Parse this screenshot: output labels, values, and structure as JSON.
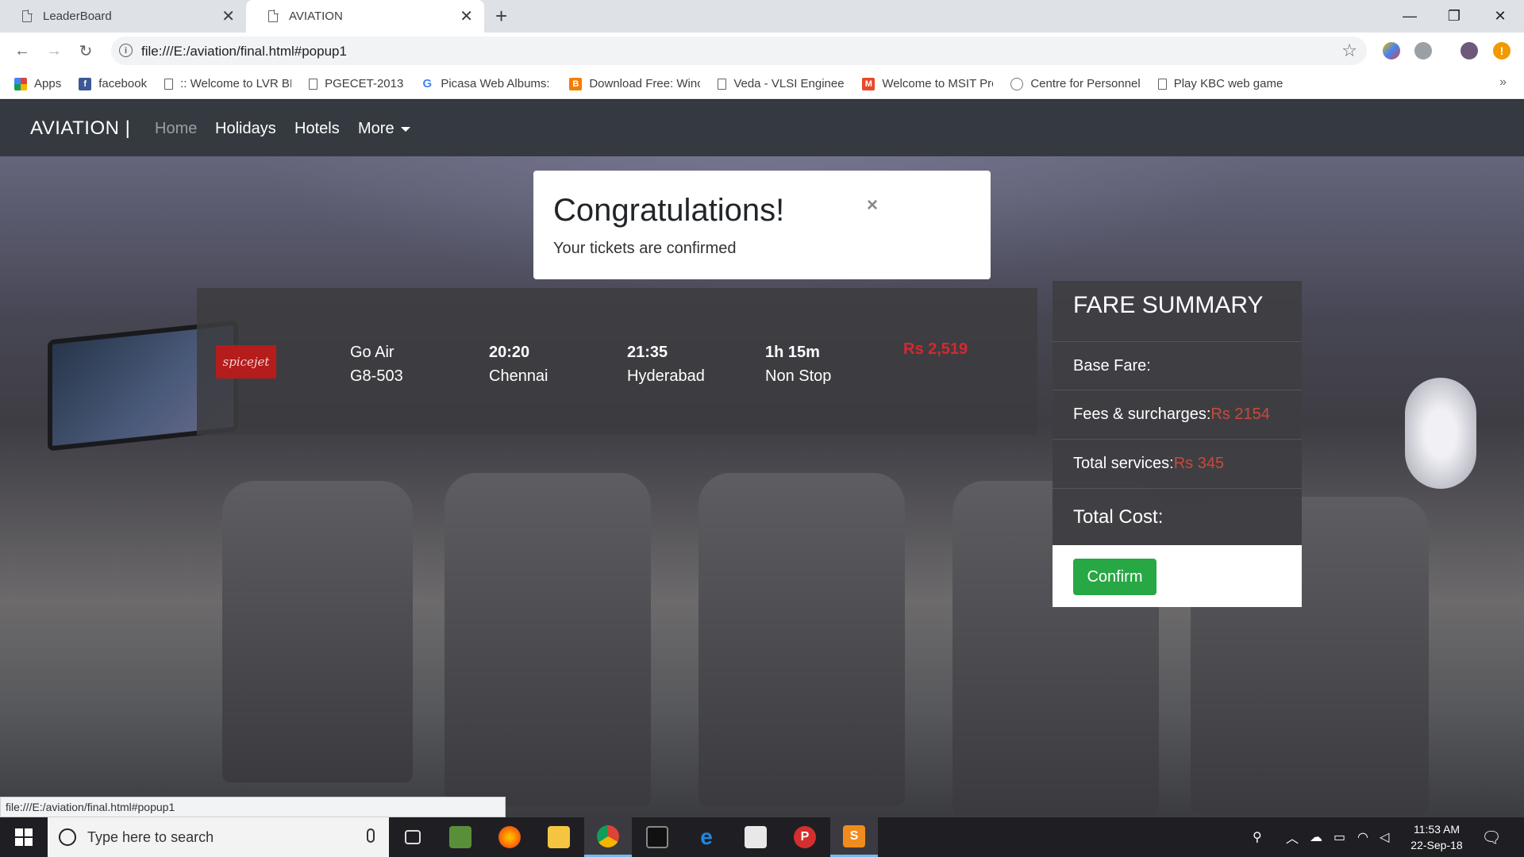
{
  "browser": {
    "tabs": [
      {
        "title": "LeaderBoard",
        "active": false
      },
      {
        "title": "AVIATION",
        "active": true
      }
    ],
    "url": "file:///E:/aviation/final.html#popup1",
    "bookmarks": [
      {
        "label": "Apps",
        "icon": "apps-grid-icon",
        "color": "#4285f4"
      },
      {
        "label": "facebook",
        "icon": "facebook-icon",
        "color": "#3b5998"
      },
      {
        "label": ":: Welcome to LVR BR",
        "icon": "document-icon",
        "color": ""
      },
      {
        "label": "PGECET-2013",
        "icon": "document-icon",
        "color": ""
      },
      {
        "label": "Picasa Web Albums: (",
        "icon": "google-icon",
        "color": "#4285f4"
      },
      {
        "label": "Download Free: Winc",
        "icon": "blogger-icon",
        "color": "#f57d00"
      },
      {
        "label": "Veda - VLSI Engineer",
        "icon": "document-icon",
        "color": ""
      },
      {
        "label": "Welcome to MSIT Prc",
        "icon": "msit-icon",
        "color": "#e8492b"
      },
      {
        "label": "Centre for Personnel",
        "icon": "emblem-icon",
        "color": "#777777"
      },
      {
        "label": "Play KBC web game o",
        "icon": "document-icon",
        "color": ""
      }
    ],
    "status_url": "file:///E:/aviation/final.html#popup1"
  },
  "site": {
    "brand": "AVIATION |",
    "nav": [
      {
        "label": "Home"
      },
      {
        "label": "Holidays"
      },
      {
        "label": "Hotels"
      },
      {
        "label": "More"
      }
    ]
  },
  "flight": {
    "airline_logo": "spicejet",
    "airline": "Go Air",
    "flight_no": "G8-503",
    "depart_time": "20:20",
    "depart_city": "Chennai",
    "arrive_time": "21:35",
    "arrive_city": "Hyderabad",
    "duration": "1h 15m",
    "stops": "Non Stop",
    "price": "Rs 2,519"
  },
  "fare_summary": {
    "title": "FARE SUMMARY",
    "base_fare_label": "Base Fare:",
    "fees_label": "Fees & surcharges:",
    "fees_value": "Rs 2154",
    "services_label": "Total services:",
    "services_value": "Rs 345",
    "total_label": "Total Cost:",
    "confirm_label": "Confirm"
  },
  "modal": {
    "title": "Congratulations!",
    "message": "Your tickets are confirmed",
    "close": "×"
  },
  "taskbar": {
    "search_placeholder": "Type here to search",
    "time": "11:53 AM",
    "date": "22-Sep-18",
    "notifications": "1"
  },
  "colors": {
    "navbar": "#343a40",
    "price": "#d9272e",
    "confirm": "#28a745"
  }
}
